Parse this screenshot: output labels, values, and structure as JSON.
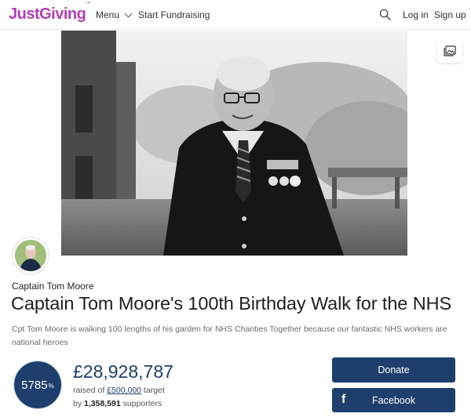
{
  "header": {
    "logo_text": "JustGiving",
    "logo_tm": "™",
    "menu_label": "Menu",
    "start_label": "Start Fundraising",
    "login_label": "Log in",
    "signup_label": "Sign up"
  },
  "page": {
    "owner_name": "Captain Tom Moore",
    "title": "Captain Tom Moore's 100th Birthday Walk for the NHS",
    "description": "Cpt Tom Moore is walking 100 lengths of his garden for NHS Charities Together because our fantastic NHS workers are national heroes"
  },
  "stats": {
    "percent_value": "5785",
    "percent_sign": "%",
    "raised": "£28,928,787",
    "raised_of": "raised of",
    "target_amount": "£500,000",
    "target_word": "target",
    "by_word": "by",
    "supporters_count": "1,358,591",
    "supporters_word": "supporters"
  },
  "actions": {
    "donate_label": "Donate",
    "facebook_label": "Facebook",
    "facebook_icon": "f"
  },
  "colors": {
    "brand": "#b23fb3",
    "primary": "#1e3f6d"
  }
}
